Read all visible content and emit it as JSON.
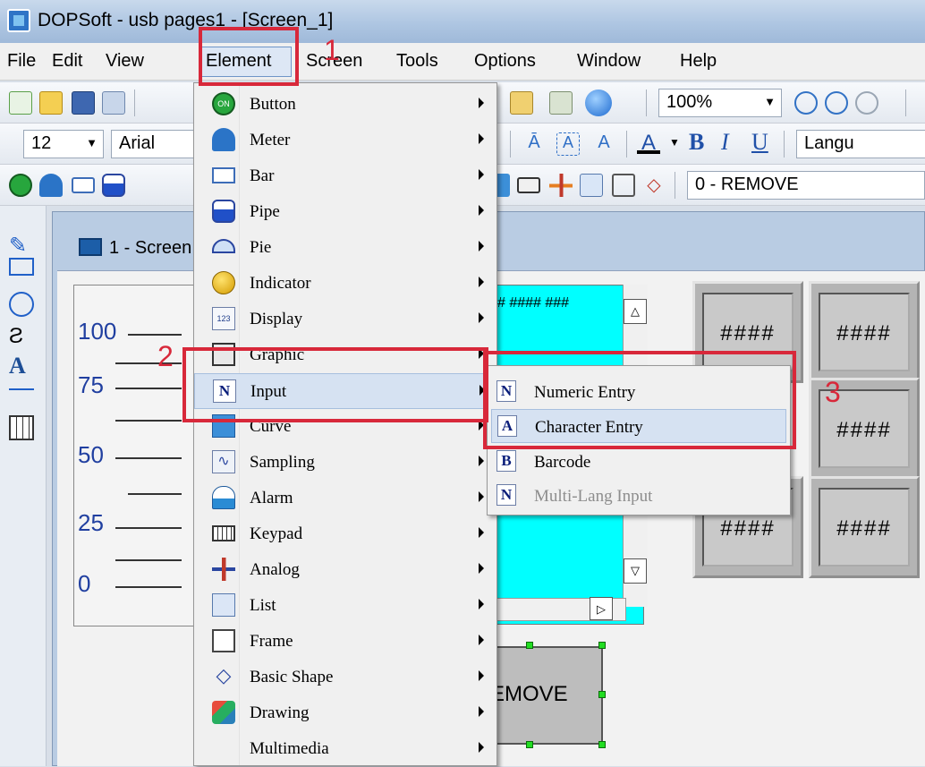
{
  "window": {
    "title": "DOPSoft - usb pages1 - [Screen_1]"
  },
  "menubar": {
    "items": [
      "File",
      "Edit",
      "View",
      "Element",
      "Screen",
      "Tools",
      "Options",
      "Window",
      "Help"
    ]
  },
  "toolbar": {
    "zoom": "100%",
    "font_size": "12",
    "font_name": "Arial",
    "language_combo": "Langu",
    "state_combo": "0 - REMOVE",
    "bold_label": "B",
    "italic_label": "I",
    "underline_label": "U",
    "font_color_label": "A"
  },
  "screen_tab": {
    "label": "1 - Screen"
  },
  "canvas": {
    "meter_labels": [
      "100",
      "75",
      "50",
      "25",
      "0"
    ],
    "hash_text": "#  ####  ###",
    "hash_button_text": "####",
    "remove_button_text": "EMOVE",
    "scroll_up": "△",
    "scroll_down": "▽",
    "scroll_right": "▷"
  },
  "element_menu": {
    "items": [
      {
        "label": "Button",
        "icon": "button-on-icon"
      },
      {
        "label": "Meter",
        "icon": "meter-icon"
      },
      {
        "label": "Bar",
        "icon": "bar-icon"
      },
      {
        "label": "Pipe",
        "icon": "pipe-icon"
      },
      {
        "label": "Pie",
        "icon": "pie-icon"
      },
      {
        "label": "Indicator",
        "icon": "indicator-icon"
      },
      {
        "label": "Display",
        "icon": "display-123-icon"
      },
      {
        "label": "Graphic",
        "icon": "graphic-icon"
      },
      {
        "label": "Input",
        "icon": "input-n-icon"
      },
      {
        "label": "Curve",
        "icon": "curve-icon"
      },
      {
        "label": "Sampling",
        "icon": "sampling-icon"
      },
      {
        "label": "Alarm",
        "icon": "alarm-icon"
      },
      {
        "label": "Keypad",
        "icon": "keypad-icon"
      },
      {
        "label": "Analog",
        "icon": "analog-icon"
      },
      {
        "label": "List",
        "icon": "list-icon"
      },
      {
        "label": "Frame",
        "icon": "frame-icon"
      },
      {
        "label": "Basic Shape",
        "icon": "basic-shape-icon"
      },
      {
        "label": "Drawing",
        "icon": "drawing-icon"
      },
      {
        "label": "Multimedia",
        "icon": "multimedia-icon"
      }
    ]
  },
  "input_submenu": {
    "items": [
      {
        "label": "Numeric Entry",
        "glyph": "N",
        "enabled": "yes"
      },
      {
        "label": "Character Entry",
        "glyph": "A",
        "enabled": "yes"
      },
      {
        "label": "Barcode",
        "glyph": "B",
        "enabled": "yes"
      },
      {
        "label": "Multi-Lang Input",
        "glyph": "N",
        "enabled": "no"
      }
    ]
  },
  "annotations": {
    "step1": "1",
    "step2": "2",
    "step3": "3"
  },
  "colors": {
    "annotation_red": "#d8283a",
    "canvas_cyan": "#00ffff",
    "menu_highlight": "#d6e2f2"
  }
}
